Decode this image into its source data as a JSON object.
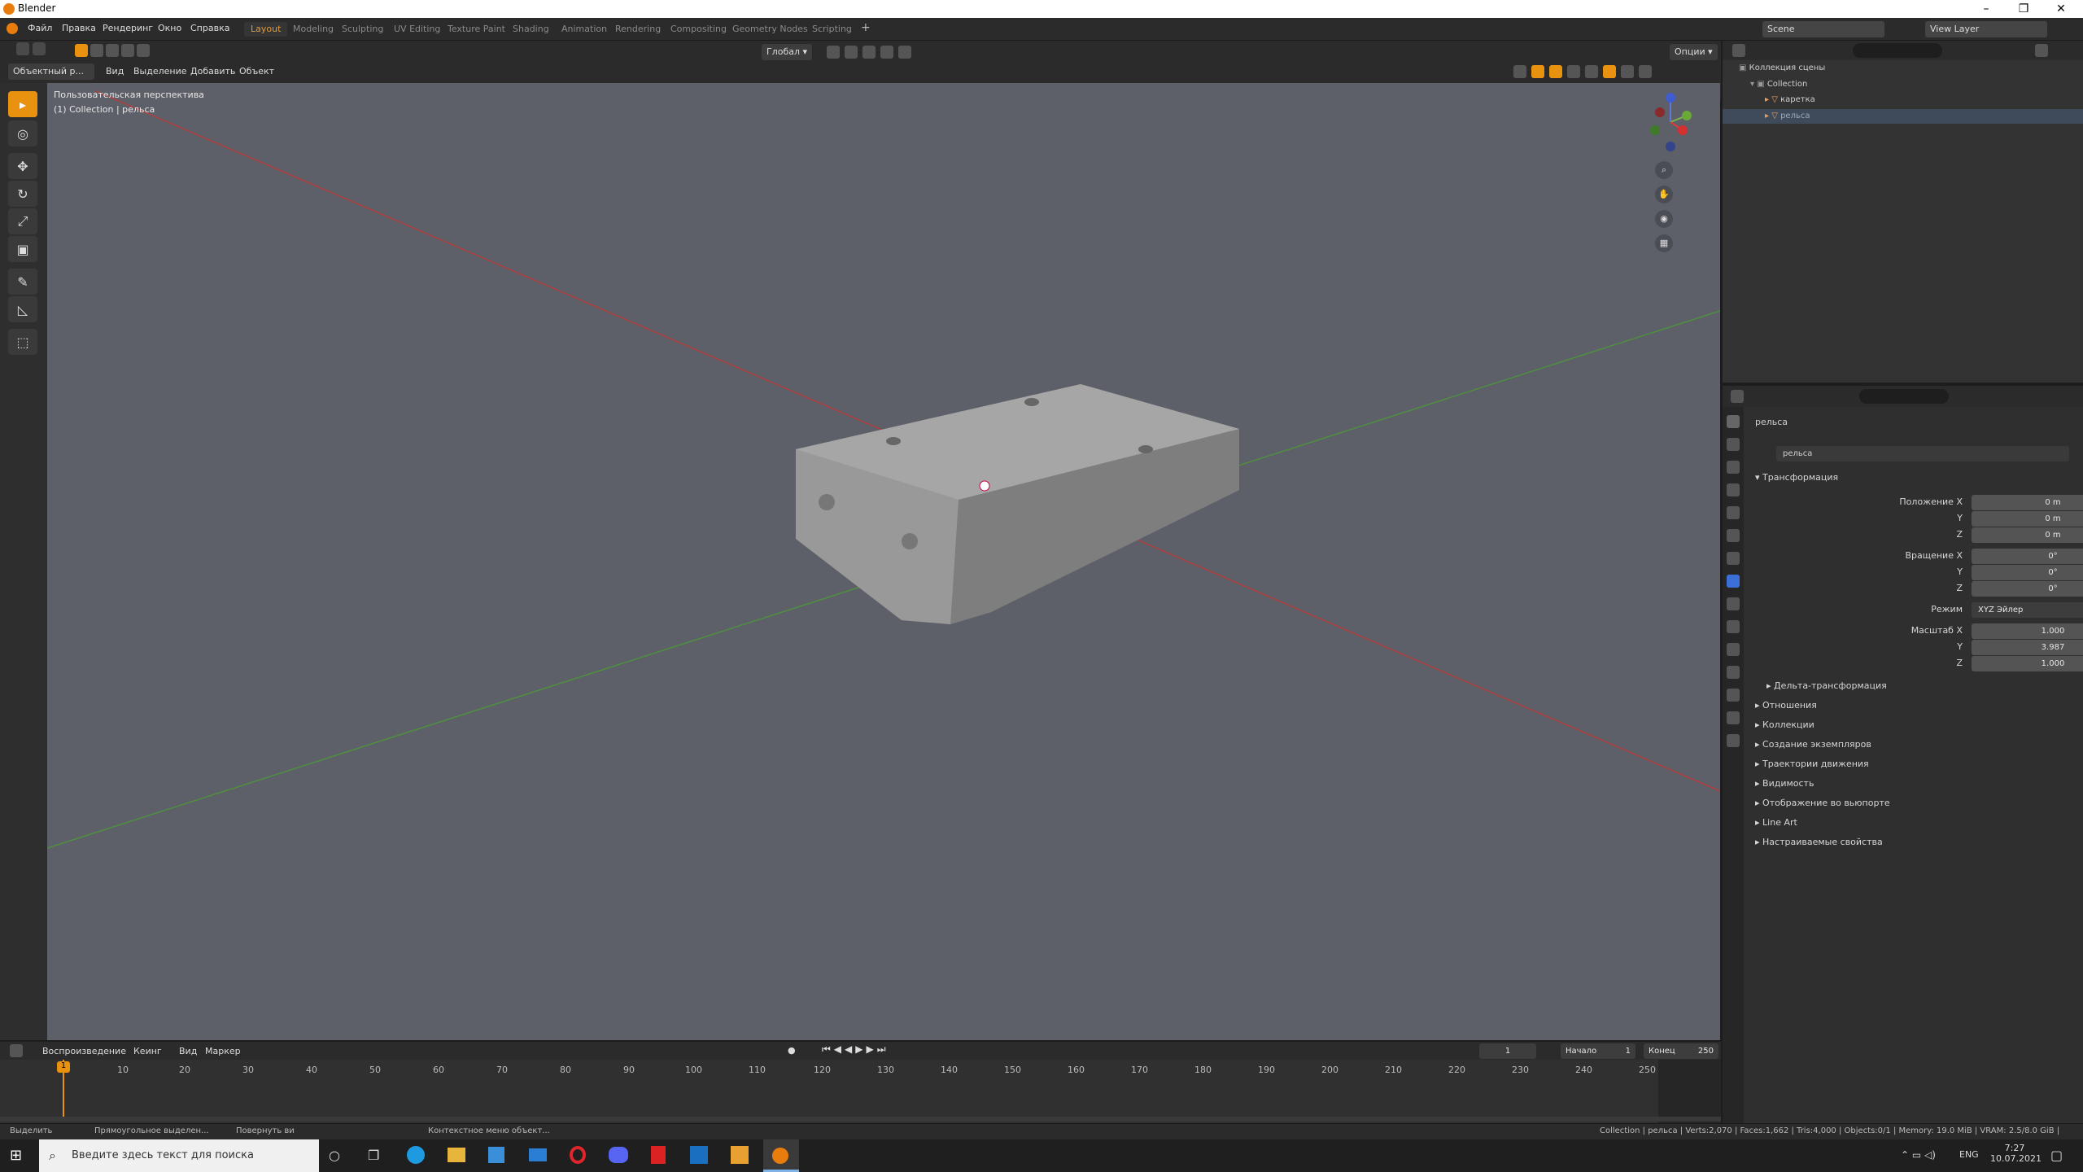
{
  "window": {
    "title": "Blender"
  },
  "menu": [
    "Файл",
    "Правка",
    "Рендеринг",
    "Окно",
    "Справка"
  ],
  "workspaces": [
    "Layout",
    "Modeling",
    "Sculpting",
    "UV Editing",
    "Texture Paint",
    "Shading",
    "Animation",
    "Rendering",
    "Compositing",
    "Geometry Nodes",
    "Scripting"
  ],
  "active_workspace": "Layout",
  "top_right": {
    "scene": "Scene",
    "view_layer": "View Layer"
  },
  "header3d": {
    "mode": "Объектный р...",
    "menus": [
      "Вид",
      "Выделение",
      "Добавить",
      "Объект"
    ],
    "orientation": "Глобал",
    "options": "Опции"
  },
  "viewport": {
    "overlay_line1": "Пользовательская перспектива",
    "overlay_line2": "(1) Collection | рельса"
  },
  "outliner": {
    "root": "Коллекция сцены",
    "collection": "Collection",
    "items": [
      "каретка",
      "рельса"
    ]
  },
  "properties": {
    "object_name": "рельса",
    "object_field": "рельса",
    "transform_header": "Трансформация",
    "location_label": "Положение X",
    "location": [
      "0 m",
      "0 m",
      "0 m"
    ],
    "rotation_label": "Вращение X",
    "rotation": [
      "0°",
      "0°",
      "0°"
    ],
    "mode_label": "Режим",
    "mode_value": "XYZ Эйлер",
    "scale_label": "Масштаб X",
    "scale": [
      "1.000",
      "3.987",
      "1.000"
    ],
    "axis_y": "Y",
    "axis_z": "Z",
    "delta": "Дельта-трансформация",
    "sections": [
      "Отношения",
      "Коллекции",
      "Создание экземпляров",
      "Траектории движения",
      "Видимость",
      "Отображение во вьюпорте",
      "Line Art",
      "Настраиваемые свойства"
    ]
  },
  "timeline": {
    "menus": [
      "Воспроизведение",
      "Кеинг",
      "Вид",
      "Маркер"
    ],
    "current_frame": "1",
    "start_label": "Начало",
    "start": "1",
    "end_label": "Конец",
    "end": "250",
    "ticks": [
      "1",
      "10",
      "20",
      "30",
      "40",
      "50",
      "60",
      "70",
      "80",
      "90",
      "100",
      "110",
      "120",
      "130",
      "140",
      "150",
      "160",
      "170",
      "180",
      "190",
      "200",
      "210",
      "220",
      "230",
      "240",
      "250"
    ]
  },
  "status": {
    "select": "Выделить",
    "box_select": "Прямоугольное выделен...",
    "rotate": "Повернуть ви",
    "context_menu": "Контекстное меню объект...",
    "stats": "Collection | рельса | Verts:2,070 | Faces:1,662 | Tris:4,000 | Objects:0/1 | Memory: 19.0 MiB | VRAM: 2.5/8.0 GiB |"
  },
  "taskbar": {
    "search_placeholder": "Введите здесь текст для поиска",
    "lang": "ENG",
    "time": "7:27",
    "date": "10.07.2021"
  },
  "colors": {
    "accent": "#e8920f",
    "viewport_bg": "#5d6068",
    "x_axis": "#b04040",
    "y_axis": "#4f8f3f"
  }
}
